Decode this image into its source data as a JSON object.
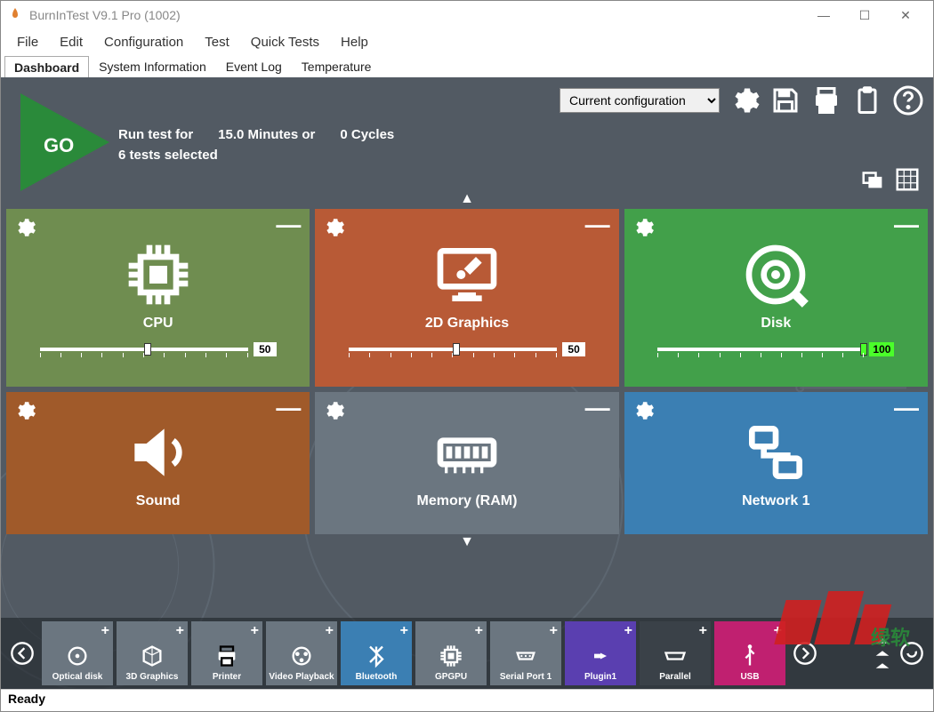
{
  "window": {
    "title": "BurnInTest V9.1 Pro (1002)"
  },
  "menubar": [
    "File",
    "Edit",
    "Configuration",
    "Test",
    "Quick Tests",
    "Help"
  ],
  "tabs": [
    "Dashboard",
    "System Information",
    "Event Log",
    "Temperature"
  ],
  "active_tab": 0,
  "run_info": {
    "line1_a": "Run test for",
    "line1_b": "15.0 Minutes or",
    "line1_c": "0 Cycles",
    "line2": "6 tests selected"
  },
  "go_label": "GO",
  "config_select": {
    "value": "Current configuration"
  },
  "tiles": [
    {
      "key": "cpu",
      "label": "CPU",
      "value": 50
    },
    {
      "key": "gfx2d",
      "label": "2D Graphics",
      "value": 50
    },
    {
      "key": "disk",
      "label": "Disk",
      "value": 100
    },
    {
      "key": "sound",
      "label": "Sound",
      "value": null
    },
    {
      "key": "memory",
      "label": "Memory (RAM)",
      "value": null
    },
    {
      "key": "network",
      "label": "Network 1",
      "value": null
    }
  ],
  "inactive_tiles": [
    {
      "label": "Optical disk",
      "color": "default",
      "icon": "disc"
    },
    {
      "label": "3D Graphics",
      "color": "default",
      "icon": "cube"
    },
    {
      "label": "Printer",
      "color": "default",
      "icon": "printer"
    },
    {
      "label": "Video Playback",
      "color": "default",
      "icon": "film"
    },
    {
      "label": "Bluetooth",
      "color": "blue",
      "icon": "bluetooth"
    },
    {
      "label": "GPGPU",
      "color": "default",
      "icon": "chip"
    },
    {
      "label": "Serial Port 1",
      "color": "default",
      "icon": "serial"
    },
    {
      "label": "Plugin1",
      "color": "purple",
      "icon": "plug"
    },
    {
      "label": "Parallel",
      "color": "dark",
      "icon": "parallel"
    },
    {
      "label": "USB",
      "color": "pink",
      "icon": "usb"
    }
  ],
  "status": "Ready",
  "watermark_text": "绿软"
}
